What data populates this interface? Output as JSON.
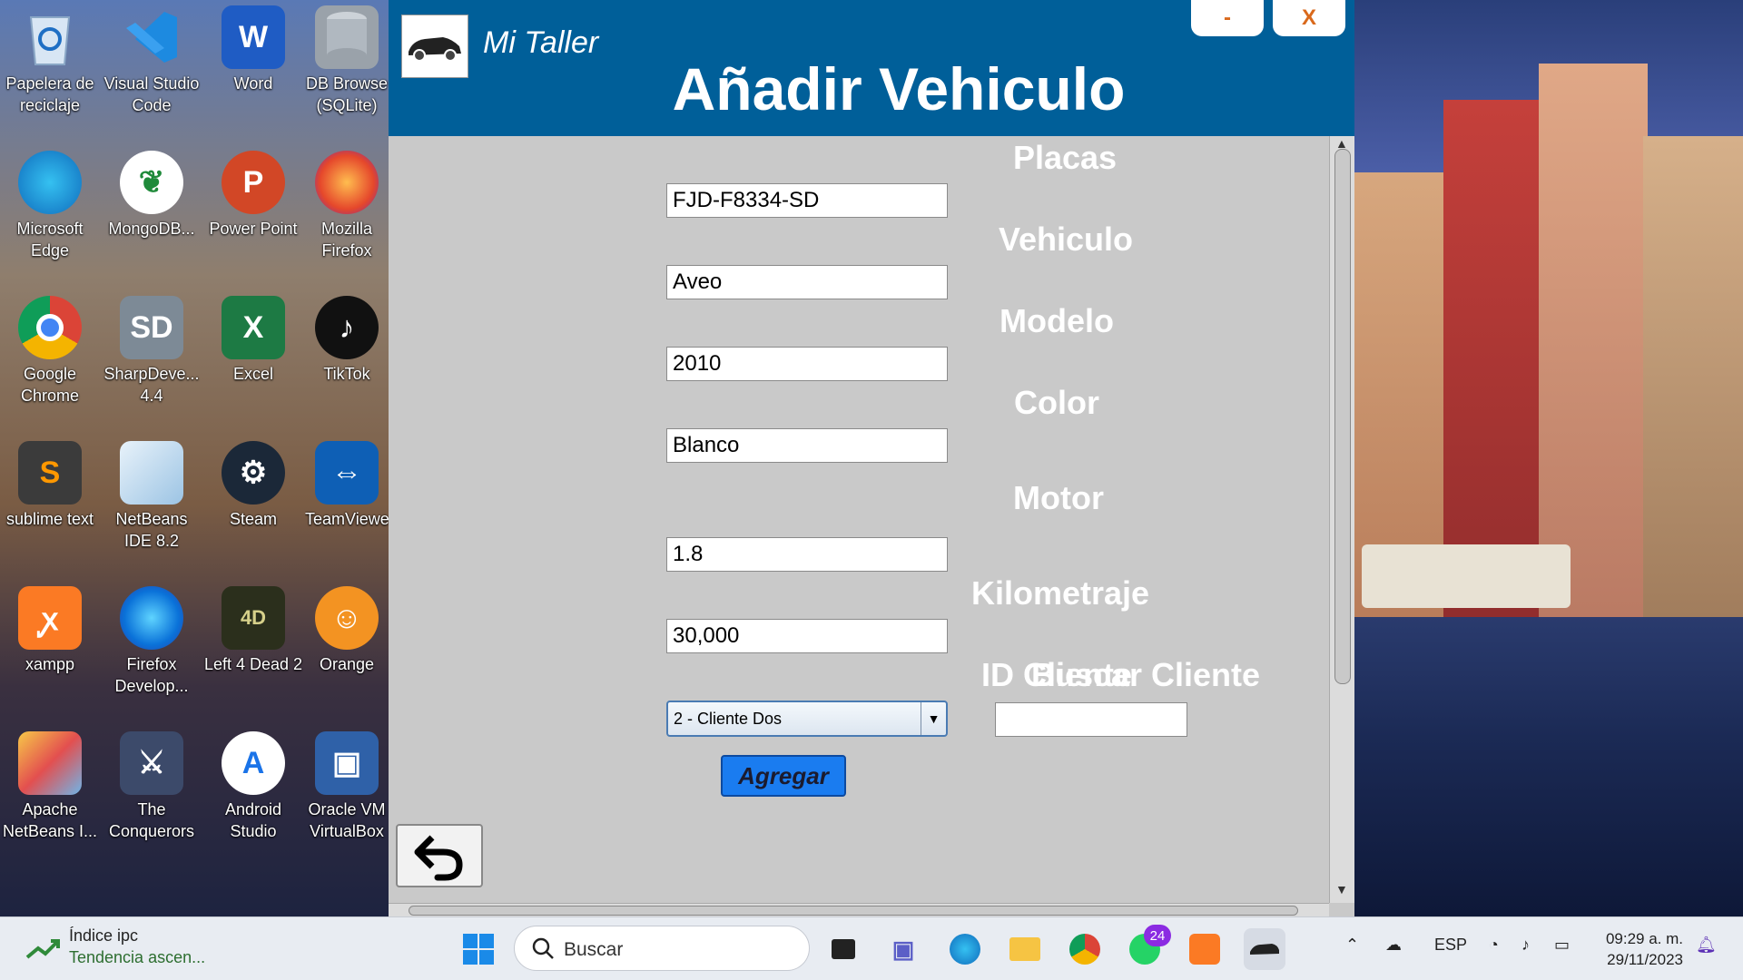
{
  "app": {
    "brand": "Mi Taller",
    "title": "Añadir Vehiculo",
    "minimize_label": "-",
    "close_label": "X"
  },
  "form": {
    "placas_label": "Placas",
    "placas_value": "FJD-F8334-SD",
    "vehiculo_label": "Vehiculo",
    "vehiculo_value": "Aveo",
    "modelo_label": "Modelo",
    "modelo_value": "2010",
    "color_label": "Color",
    "color_value": "Blanco",
    "motor_label": "Motor",
    "motor_value": "1.8",
    "kilometraje_label": "Kilometraje",
    "kilometraje_value": "30,000",
    "id_cliente_label": "ID Cliente",
    "id_cliente_selected": "2 - Cliente Dos",
    "buscar_cliente_label": "Buscar Cliente",
    "buscar_cliente_value": "",
    "agregar_label": "Agregar"
  },
  "desktop": {
    "icons": [
      {
        "label": "Papelera de reciclaje",
        "icon": "recycle-bin-icon"
      },
      {
        "label": "Visual Studio Code",
        "icon": "vscode-icon"
      },
      {
        "label": "Word",
        "icon": "word-icon"
      },
      {
        "label": "DB Browse (SQLite)",
        "icon": "database-icon"
      },
      {
        "label": "Microsoft Edge",
        "icon": "edge-icon"
      },
      {
        "label": "MongoDB...",
        "icon": "mongodb-icon"
      },
      {
        "label": "Power Point",
        "icon": "powerpoint-icon"
      },
      {
        "label": "Mozilla Firefox",
        "icon": "firefox-icon"
      },
      {
        "label": "Google Chrome",
        "icon": "chrome-icon"
      },
      {
        "label": "SharpDeve... 4.4",
        "icon": "sharpdevelop-icon"
      },
      {
        "label": "Excel",
        "icon": "excel-icon"
      },
      {
        "label": "TikTok",
        "icon": "tiktok-icon"
      },
      {
        "label": "sublime text",
        "icon": "sublime-icon"
      },
      {
        "label": "NetBeans IDE 8.2",
        "icon": "netbeans-icon"
      },
      {
        "label": "Steam",
        "icon": "steam-icon"
      },
      {
        "label": "TeamViewe",
        "icon": "teamviewer-icon"
      },
      {
        "label": "xampp",
        "icon": "xampp-icon"
      },
      {
        "label": "Firefox Develop...",
        "icon": "firefox-dev-icon"
      },
      {
        "label": "Left 4 Dead 2",
        "icon": "l4d2-icon"
      },
      {
        "label": "Orange",
        "icon": "orange-icon"
      },
      {
        "label": "Apache NetBeans I...",
        "icon": "apache-netbeans-icon"
      },
      {
        "label": "The Conquerors",
        "icon": "conquerors-icon"
      },
      {
        "label": "Android Studio",
        "icon": "android-studio-icon"
      },
      {
        "label": "Oracle VM VirtualBox",
        "icon": "virtualbox-icon"
      }
    ]
  },
  "taskbar": {
    "widget_title": "Índice ipc",
    "widget_subtitle": "Tendencia ascen...",
    "search_placeholder": "Buscar",
    "whatsapp_badge": "24",
    "language": "ESP",
    "time": "09:29 a. m.",
    "date": "29/11/2023"
  },
  "colors": {
    "header_bg": "#005f99",
    "form_bg": "#c9c9c9",
    "accent_button": "#1a7cf0"
  }
}
